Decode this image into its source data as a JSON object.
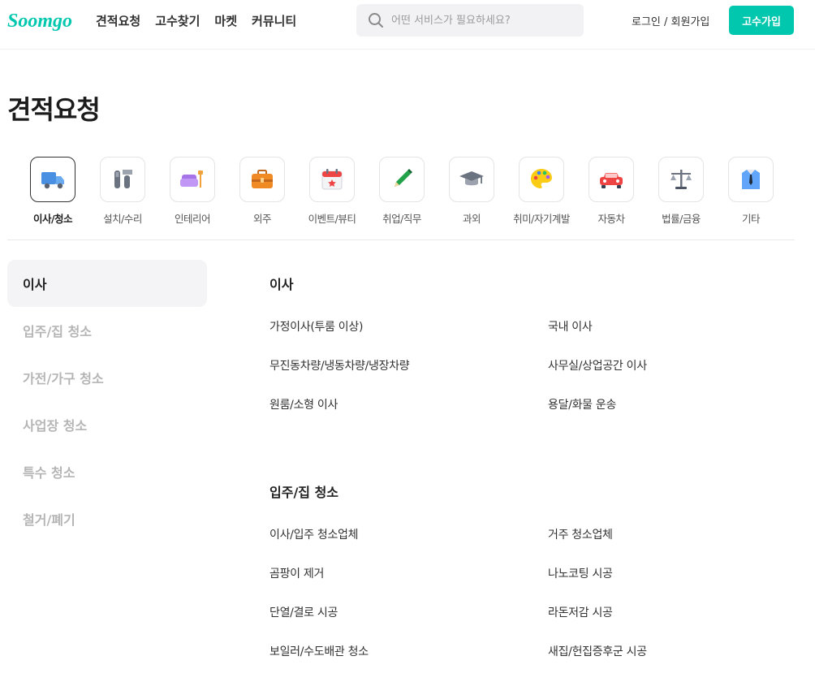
{
  "header": {
    "logo_text": "Soomgo",
    "nav": [
      "견적요청",
      "고수찾기",
      "마켓",
      "커뮤니티"
    ],
    "search_placeholder": "어떤 서비스가 필요하세요?",
    "login_label": "로그인 / 회원가입",
    "pro_signup_label": "고수가입"
  },
  "page_title": "견적요청",
  "categories": [
    {
      "label": "이사/청소",
      "icon": "truck-icon",
      "active": true
    },
    {
      "label": "설치/수리",
      "icon": "tools-icon"
    },
    {
      "label": "인테리어",
      "icon": "sofa-icon"
    },
    {
      "label": "외주",
      "icon": "briefcase-icon"
    },
    {
      "label": "이벤트/뷰티",
      "icon": "calendar-icon"
    },
    {
      "label": "취업/직무",
      "icon": "pencil-icon"
    },
    {
      "label": "과외",
      "icon": "graduation-cap-icon"
    },
    {
      "label": "취미/자기계발",
      "icon": "palette-icon"
    },
    {
      "label": "자동차",
      "icon": "car-icon"
    },
    {
      "label": "법률/금융",
      "icon": "scales-icon"
    },
    {
      "label": "기타",
      "icon": "shirt-icon"
    }
  ],
  "sidebar": {
    "items": [
      "이사",
      "입주/집 청소",
      "가전/가구 청소",
      "사업장 청소",
      "특수 청소",
      "철거/폐기"
    ],
    "active_index": 0
  },
  "sections": [
    {
      "title": "이사",
      "services": [
        "가정이사(투룸 이상)",
        "국내 이사",
        "무진동차량/냉동차량/냉장차량",
        "사무실/상업공간 이사",
        "원룸/소형 이사",
        "용달/화물 운송"
      ]
    },
    {
      "title": "입주/집 청소",
      "services": [
        "이사/입주 청소업체",
        "거주 청소업체",
        "곰팡이 제거",
        "나노코팅 시공",
        "단열/결로 시공",
        "라돈저감 시공",
        "보일러/수도배관 청소",
        "새집/헌집증후군 시공"
      ]
    }
  ],
  "colors": {
    "brand": "#00c7ae",
    "text": "#323232",
    "muted": "#b5b5b5"
  }
}
